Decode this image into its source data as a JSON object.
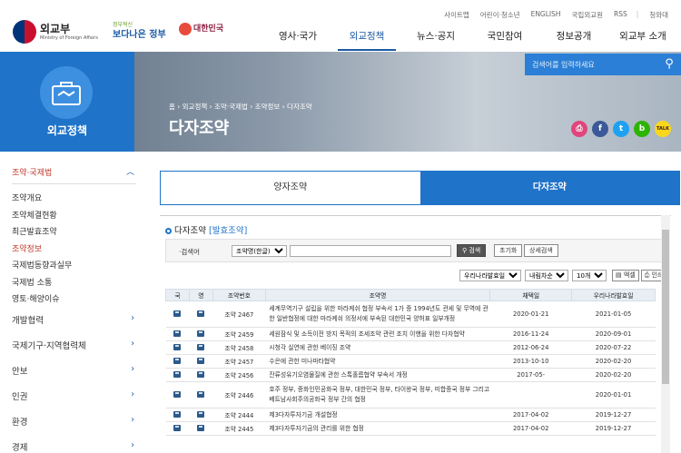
{
  "header": {
    "logo_ko": "외교부",
    "logo_en": "Ministry of Foreign Affairs",
    "innov_top": "정부혁신",
    "innov_main": "보다나은 정부",
    "daehan": "대한민국",
    "util": [
      "사이트맵",
      "어린이·청소년",
      "ENGLISH",
      "국립외교원",
      "RSS",
      "청와대"
    ],
    "gnb": [
      "영사·국가",
      "외교정책",
      "뉴스·공지",
      "국민참여",
      "정보공개",
      "외교부 소개"
    ]
  },
  "banner": {
    "menu_label": "외교정책",
    "search_placeholder": "검색어를 입력하세요",
    "breadcrumb": "홈 › 외교정책 › 조약·국제법 › 조약정보 › 다자조약",
    "title": "다자조약"
  },
  "sidebar": {
    "top": "조약·국제법",
    "sub": [
      "조약개요",
      "조약체결현황",
      "최근발효조약",
      "조약정보",
      "국제법동향과실무",
      "국제법 소통",
      "영토·해양이슈"
    ],
    "main": [
      "개발협력",
      "국제기구·지역협력체",
      "안보",
      "인권",
      "환경",
      "경제"
    ]
  },
  "content": {
    "tab1": "양자조약",
    "tab2": "다자조약",
    "panel_title": "다자조약",
    "panel_link": "[발효조약]",
    "search_label": "·검색어",
    "search_select": "조약명(한글)",
    "btn_search": "검색",
    "btn_reset": "초기화",
    "btn_detail": "상세검색",
    "filter_sort": "우리나라발효일",
    "filter_order": "내림차순",
    "filter_count": "10개",
    "btn_excel": "엑셀",
    "btn_print": "인쇄",
    "columns": [
      "국",
      "영",
      "조약번호",
      "조약명",
      "채택일",
      "우리나라발효일"
    ],
    "rows": [
      {
        "no": "조약 2467",
        "name": "세계무역기구 설립을 위한 마라케쉬 협정 부속서 1가 중 1994년도 관세 및 무역에 관한 일반협정에 대한 마라케쉬 의정서에 부속된 대한민국 양허표 일부개정",
        "adopt": "2020-01-21",
        "effect": "2021-01-05"
      },
      {
        "no": "조약 2459",
        "name": "세원잠식 및 소득이전 방지 목적의 조세조약 관련 조치 이행을 위한 다자협약",
        "adopt": "2016-11-24",
        "effect": "2020-09-01"
      },
      {
        "no": "조약 2458",
        "name": "시청각 실연에 관한 베이징 조약",
        "adopt": "2012-06-24",
        "effect": "2020-07-22"
      },
      {
        "no": "조약 2457",
        "name": "수은에 관한 미나마타협약",
        "adopt": "2013-10-10",
        "effect": "2020-02-20"
      },
      {
        "no": "조약 2456",
        "name": "잔류성유기오염물질에 관한 스톡홀름협약 부속서 개정",
        "adopt": "2017-05-",
        "effect": "2020-02-20"
      },
      {
        "no": "조약 2446",
        "name": "호주 정부, 중화인민공화국 정부, 대한민국 정부, 타이왕국 정부, 미합중국 정부 그리고 베트남사회주의공화국 정부 간의 협정",
        "adopt": "",
        "effect": "2020-01-01"
      },
      {
        "no": "조약 2444",
        "name": "제3다자투자기금 개설협정",
        "adopt": "2017-04-02",
        "effect": "2019-12-27"
      },
      {
        "no": "조약 2445",
        "name": "제3다자투자기금의 관리를 위한 협정",
        "adopt": "2017-04-02",
        "effect": "2019-12-27"
      }
    ]
  },
  "share": [
    {
      "label": "⎙",
      "color": "#e0457b"
    },
    {
      "label": "f",
      "color": "#3b5998"
    },
    {
      "label": "t",
      "color": "#1da1f2"
    },
    {
      "label": "b",
      "color": "#2db400"
    },
    {
      "label": "TALK",
      "color": "#f9d71c"
    }
  ]
}
